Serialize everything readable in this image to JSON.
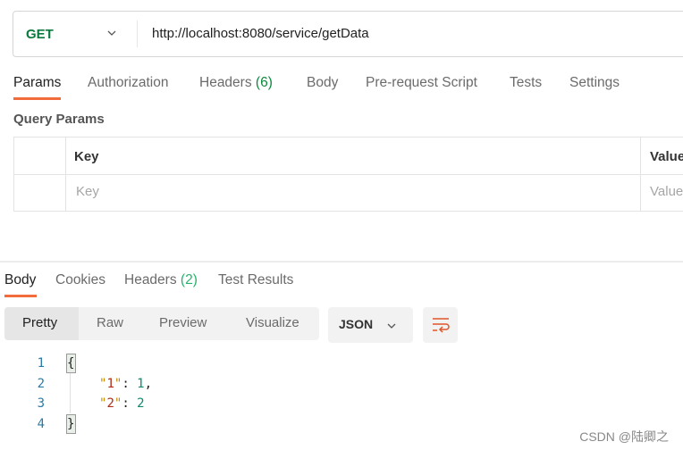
{
  "request": {
    "method": "GET",
    "url": "http://localhost:8080/service/getData"
  },
  "request_tabs": [
    {
      "label": "Params",
      "active": true
    },
    {
      "label": "Authorization"
    },
    {
      "label": "Headers",
      "count": "(6)"
    },
    {
      "label": "Body"
    },
    {
      "label": "Pre-request Script"
    },
    {
      "label": "Tests"
    },
    {
      "label": "Settings"
    }
  ],
  "query_params": {
    "title": "Query Params",
    "headers": [
      "Key",
      "Value"
    ],
    "placeholders": [
      "Key",
      "Value"
    ]
  },
  "response_tabs": [
    {
      "label": "Body",
      "active": true
    },
    {
      "label": "Cookies"
    },
    {
      "label": "Headers",
      "count": "(2)"
    },
    {
      "label": "Test Results"
    }
  ],
  "view_modes": [
    "Pretty",
    "Raw",
    "Preview",
    "Visualize"
  ],
  "format": "JSON",
  "icons": {
    "method_dropdown": "chevron-down-icon",
    "format_dropdown": "chevron-down-icon",
    "wrap": "wrap-lines-icon"
  },
  "colors": {
    "accent": "#f26b3a",
    "method": "#0b7a3e"
  },
  "code": {
    "line_numbers": [
      "1",
      "2",
      "3",
      "4"
    ],
    "open": "{",
    "close": "}",
    "lines": [
      {
        "key": "1",
        "value": "1",
        "comma": ","
      },
      {
        "key": "2",
        "value": "2",
        "comma": ""
      }
    ]
  },
  "watermark": "CSDN @陆卿之"
}
